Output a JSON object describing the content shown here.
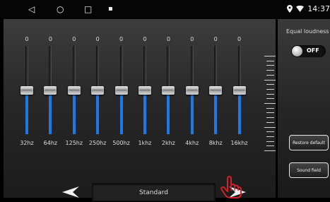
{
  "status_bar": {
    "back_icon": "◁",
    "home_icon": "○",
    "recents_icon": "□",
    "notification_icon": "▪",
    "time": "14:37"
  },
  "equalizer": {
    "band_value_label": "0",
    "level": 0.5,
    "bands": [
      {
        "freq": "32hz",
        "value": "0"
      },
      {
        "freq": "64hz",
        "value": "0"
      },
      {
        "freq": "125hz",
        "value": "0"
      },
      {
        "freq": "250hz",
        "value": "0"
      },
      {
        "freq": "500hz",
        "value": "0"
      },
      {
        "freq": "1khz",
        "value": "0"
      },
      {
        "freq": "2khz",
        "value": "0"
      },
      {
        "freq": "4khz",
        "value": "0"
      },
      {
        "freq": "8khz",
        "value": "0"
      },
      {
        "freq": "16khz",
        "value": "0"
      }
    ]
  },
  "preset": {
    "label": "Standard",
    "prev_icon": "arrow-left-icon",
    "next_icon": "arrow-right-icon"
  },
  "side_panel": {
    "loudness_label": "Equal loudness",
    "loudness_state": "OFF",
    "restore_label": "Restore default",
    "soundfield_label": "Sound field"
  },
  "colors": {
    "accent": "#1f78e6",
    "pointer": "#d4202a"
  }
}
